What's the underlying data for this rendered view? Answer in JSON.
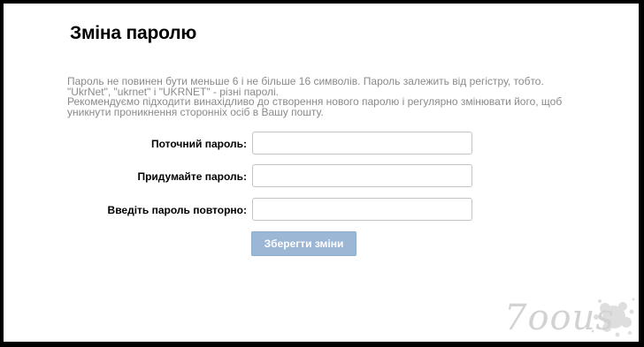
{
  "page": {
    "title": "Зміна паролю"
  },
  "info": {
    "line1": "Пароль не повинен бути меньше 6 і не більше 16 символів. Пароль залежить від регістру, тобто. \"UkrNet\", \"ukrnet\" і \"UKRNET\" - різні паролі.",
    "line2": "Рекомендуємо підходити винахідливо до створення нового паролю і регулярно змінювати його, щоб уникнути проникнення сторонніх осіб в Вашу пошту."
  },
  "form": {
    "current_label": "Поточний пароль:",
    "current_value": "",
    "new_label": "Придумайте пароль:",
    "new_value": "",
    "repeat_label": "Введіть пароль повторно:",
    "repeat_value": "",
    "submit_label": "Зберегти зміни"
  },
  "watermark": {
    "text": "7oous"
  },
  "colors": {
    "button": "#9cb6d6",
    "info_text": "#8a8a8a"
  }
}
